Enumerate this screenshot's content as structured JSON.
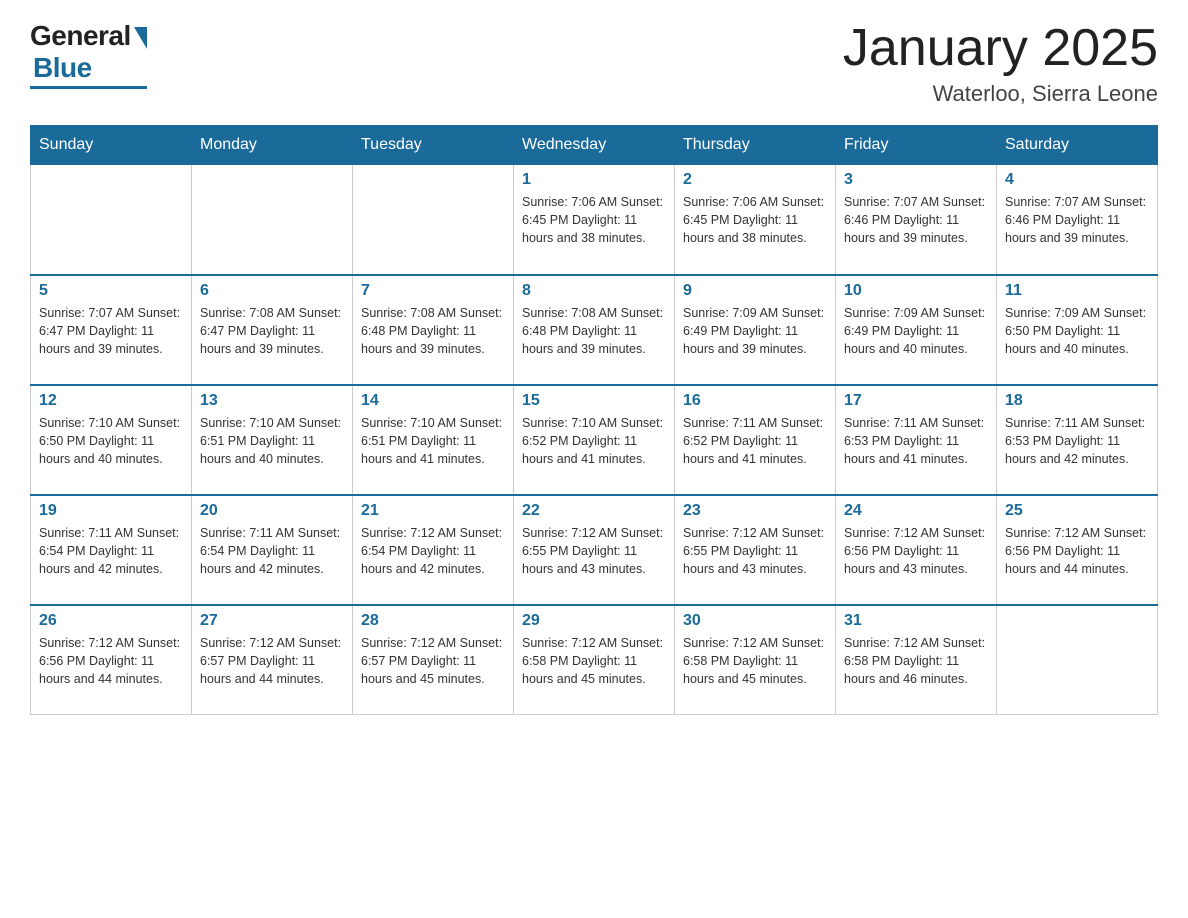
{
  "header": {
    "logo_general": "General",
    "logo_blue": "Blue",
    "month_title": "January 2025",
    "location": "Waterloo, Sierra Leone"
  },
  "days_of_week": [
    "Sunday",
    "Monday",
    "Tuesday",
    "Wednesday",
    "Thursday",
    "Friday",
    "Saturday"
  ],
  "weeks": [
    [
      {
        "day": "",
        "info": ""
      },
      {
        "day": "",
        "info": ""
      },
      {
        "day": "",
        "info": ""
      },
      {
        "day": "1",
        "info": "Sunrise: 7:06 AM\nSunset: 6:45 PM\nDaylight: 11 hours\nand 38 minutes."
      },
      {
        "day": "2",
        "info": "Sunrise: 7:06 AM\nSunset: 6:45 PM\nDaylight: 11 hours\nand 38 minutes."
      },
      {
        "day": "3",
        "info": "Sunrise: 7:07 AM\nSunset: 6:46 PM\nDaylight: 11 hours\nand 39 minutes."
      },
      {
        "day": "4",
        "info": "Sunrise: 7:07 AM\nSunset: 6:46 PM\nDaylight: 11 hours\nand 39 minutes."
      }
    ],
    [
      {
        "day": "5",
        "info": "Sunrise: 7:07 AM\nSunset: 6:47 PM\nDaylight: 11 hours\nand 39 minutes."
      },
      {
        "day": "6",
        "info": "Sunrise: 7:08 AM\nSunset: 6:47 PM\nDaylight: 11 hours\nand 39 minutes."
      },
      {
        "day": "7",
        "info": "Sunrise: 7:08 AM\nSunset: 6:48 PM\nDaylight: 11 hours\nand 39 minutes."
      },
      {
        "day": "8",
        "info": "Sunrise: 7:08 AM\nSunset: 6:48 PM\nDaylight: 11 hours\nand 39 minutes."
      },
      {
        "day": "9",
        "info": "Sunrise: 7:09 AM\nSunset: 6:49 PM\nDaylight: 11 hours\nand 39 minutes."
      },
      {
        "day": "10",
        "info": "Sunrise: 7:09 AM\nSunset: 6:49 PM\nDaylight: 11 hours\nand 40 minutes."
      },
      {
        "day": "11",
        "info": "Sunrise: 7:09 AM\nSunset: 6:50 PM\nDaylight: 11 hours\nand 40 minutes."
      }
    ],
    [
      {
        "day": "12",
        "info": "Sunrise: 7:10 AM\nSunset: 6:50 PM\nDaylight: 11 hours\nand 40 minutes."
      },
      {
        "day": "13",
        "info": "Sunrise: 7:10 AM\nSunset: 6:51 PM\nDaylight: 11 hours\nand 40 minutes."
      },
      {
        "day": "14",
        "info": "Sunrise: 7:10 AM\nSunset: 6:51 PM\nDaylight: 11 hours\nand 41 minutes."
      },
      {
        "day": "15",
        "info": "Sunrise: 7:10 AM\nSunset: 6:52 PM\nDaylight: 11 hours\nand 41 minutes."
      },
      {
        "day": "16",
        "info": "Sunrise: 7:11 AM\nSunset: 6:52 PM\nDaylight: 11 hours\nand 41 minutes."
      },
      {
        "day": "17",
        "info": "Sunrise: 7:11 AM\nSunset: 6:53 PM\nDaylight: 11 hours\nand 41 minutes."
      },
      {
        "day": "18",
        "info": "Sunrise: 7:11 AM\nSunset: 6:53 PM\nDaylight: 11 hours\nand 42 minutes."
      }
    ],
    [
      {
        "day": "19",
        "info": "Sunrise: 7:11 AM\nSunset: 6:54 PM\nDaylight: 11 hours\nand 42 minutes."
      },
      {
        "day": "20",
        "info": "Sunrise: 7:11 AM\nSunset: 6:54 PM\nDaylight: 11 hours\nand 42 minutes."
      },
      {
        "day": "21",
        "info": "Sunrise: 7:12 AM\nSunset: 6:54 PM\nDaylight: 11 hours\nand 42 minutes."
      },
      {
        "day": "22",
        "info": "Sunrise: 7:12 AM\nSunset: 6:55 PM\nDaylight: 11 hours\nand 43 minutes."
      },
      {
        "day": "23",
        "info": "Sunrise: 7:12 AM\nSunset: 6:55 PM\nDaylight: 11 hours\nand 43 minutes."
      },
      {
        "day": "24",
        "info": "Sunrise: 7:12 AM\nSunset: 6:56 PM\nDaylight: 11 hours\nand 43 minutes."
      },
      {
        "day": "25",
        "info": "Sunrise: 7:12 AM\nSunset: 6:56 PM\nDaylight: 11 hours\nand 44 minutes."
      }
    ],
    [
      {
        "day": "26",
        "info": "Sunrise: 7:12 AM\nSunset: 6:56 PM\nDaylight: 11 hours\nand 44 minutes."
      },
      {
        "day": "27",
        "info": "Sunrise: 7:12 AM\nSunset: 6:57 PM\nDaylight: 11 hours\nand 44 minutes."
      },
      {
        "day": "28",
        "info": "Sunrise: 7:12 AM\nSunset: 6:57 PM\nDaylight: 11 hours\nand 45 minutes."
      },
      {
        "day": "29",
        "info": "Sunrise: 7:12 AM\nSunset: 6:58 PM\nDaylight: 11 hours\nand 45 minutes."
      },
      {
        "day": "30",
        "info": "Sunrise: 7:12 AM\nSunset: 6:58 PM\nDaylight: 11 hours\nand 45 minutes."
      },
      {
        "day": "31",
        "info": "Sunrise: 7:12 AM\nSunset: 6:58 PM\nDaylight: 11 hours\nand 46 minutes."
      },
      {
        "day": "",
        "info": ""
      }
    ]
  ]
}
